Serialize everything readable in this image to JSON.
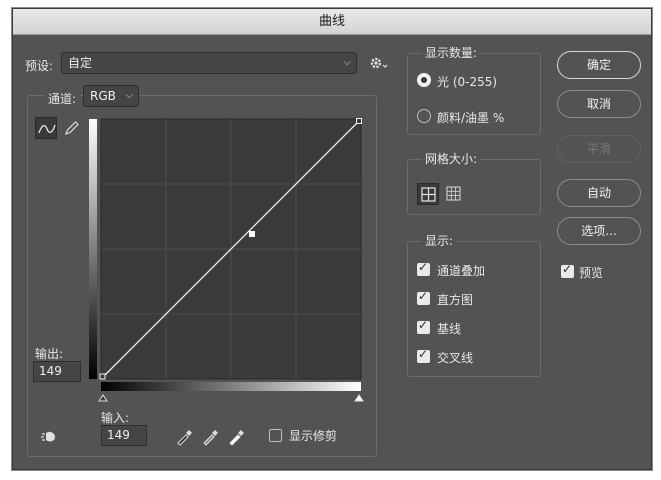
{
  "window": {
    "title": "曲线"
  },
  "preset": {
    "label": "预设:",
    "value": "自定"
  },
  "channel": {
    "label": "通道:",
    "value": "RGB"
  },
  "output": {
    "label": "输出:",
    "value": "149"
  },
  "input": {
    "label": "输入:",
    "value": "149"
  },
  "show_clipping": {
    "label": "显示修剪",
    "checked": false
  },
  "show_amount": {
    "title": "显示数量:",
    "options": [
      {
        "label": "光 (0-255)",
        "selected": true
      },
      {
        "label": "颜料/油墨 %",
        "selected": false
      }
    ]
  },
  "grid_size": {
    "title": "网格大小:"
  },
  "show": {
    "title": "显示:",
    "options": [
      {
        "label": "通道叠加",
        "checked": true
      },
      {
        "label": "直方图",
        "checked": true
      },
      {
        "label": "基线",
        "checked": true
      },
      {
        "label": "交叉线",
        "checked": true
      }
    ]
  },
  "buttons": {
    "ok": "确定",
    "cancel": "取消",
    "smooth": "平滑",
    "auto": "自动",
    "options": "选项..."
  },
  "preview": {
    "label": "预览",
    "checked": true
  },
  "icons": {
    "gear": "gear-icon",
    "curve_tool": "curve-point-icon",
    "pencil": "pencil-icon",
    "hand": "on-image-adjust-icon",
    "eyedroppers": [
      "black-point-eyedropper-icon",
      "gray-point-eyedropper-icon",
      "white-point-eyedropper-icon"
    ]
  }
}
